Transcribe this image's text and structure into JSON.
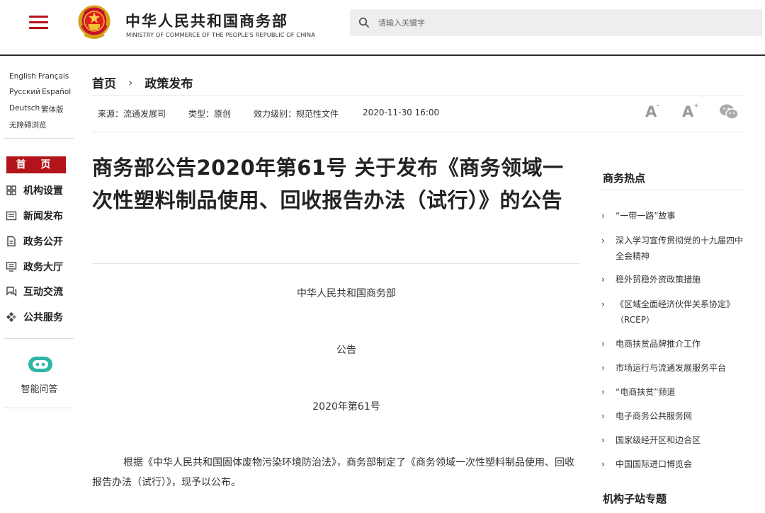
{
  "header": {
    "site_title_cn": "中华人民共和国商务部",
    "site_title_en": "MINISTRY OF COMMERCE OF THE PEOPLE'S REPUBLIC OF CHINA",
    "search_placeholder": "请输入关键字",
    "brand_color": "#b3141b"
  },
  "languages": [
    "English",
    "Français",
    "Русский",
    "Español",
    "Deutsch",
    "繁体版",
    "无障碍浏览"
  ],
  "sidebar": {
    "home_label": "首 页",
    "items": [
      {
        "label": "机构设置",
        "icon": "grid-icon"
      },
      {
        "label": "新闻发布",
        "icon": "news-icon"
      },
      {
        "label": "政务公开",
        "icon": "document-icon"
      },
      {
        "label": "政务大厅",
        "icon": "monitor-icon"
      },
      {
        "label": "互动交流",
        "icon": "chat-icon"
      },
      {
        "label": "公共服务",
        "icon": "service-icon"
      }
    ],
    "ai_label": "智能问答"
  },
  "breadcrumb": {
    "home": "首页",
    "separator": "›",
    "current": "政策发布"
  },
  "meta": {
    "source": "来源：流通发展司",
    "type": "类型：原创",
    "level": "效力级别：规范性文件",
    "date": "2020-11-30 16:00",
    "font_small": "A",
    "font_large": "A",
    "font_small_sup": "-",
    "font_large_sup": "+"
  },
  "article": {
    "title": "商务部公告2020年第61号 关于发布《商务领域一次性塑料制品使用、回收报告办法（试行）》的公告",
    "issuer": "中华人民共和国商务部",
    "doc_type": "公告",
    "doc_number": "2020年第61号",
    "paragraph": "根据《中华人民共和国固体废物污染环境防治法》，商务部制定了《商务领域一次性塑料制品使用、回收报告办法（试行）》，现予以公布。"
  },
  "right_column": {
    "hot_heading": "商务热点",
    "hot_items": [
      "“一带一路”故事",
      "深入学习宣传贯彻党的十九届四中全会精神",
      "稳外贸稳外资政策措施",
      "《区域全面经济伙伴关系协定》（RCEP）",
      "电商扶贫品牌推介工作",
      "市场运行与流通发展服务平台",
      "“电商扶贫”频道",
      "电子商务公共服务网",
      "国家级经开区和边合区",
      "中国国际进口博览会"
    ],
    "chevron": "›",
    "sub_heading": "机构子站专题"
  }
}
